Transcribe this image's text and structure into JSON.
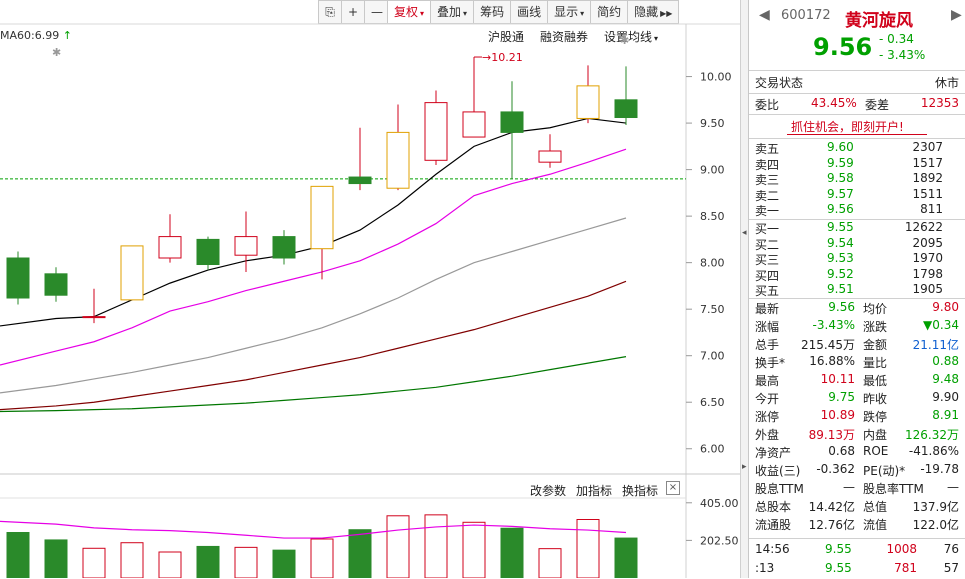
{
  "toolbar": {
    "items": [
      {
        "label": "复权",
        "active": true,
        "caret": "▾"
      },
      {
        "label": "叠加",
        "active": false,
        "caret": "▾"
      },
      {
        "label": "筹码",
        "active": false,
        "caret": ""
      },
      {
        "label": "画线",
        "active": false,
        "caret": ""
      },
      {
        "label": "显示",
        "active": false,
        "caret": "▾"
      },
      {
        "label": "简约",
        "active": false,
        "caret": ""
      },
      {
        "label": "隐藏",
        "active": false,
        "caret": "▶▶"
      }
    ],
    "icon_buttons": [
      "restore-icon",
      "plus-icon",
      "minus-icon"
    ]
  },
  "chart_header": {
    "ma60_label": "MA60:6.99",
    "links": [
      "沪股通",
      "融资融券",
      "设置均线"
    ],
    "settings_caret": "▾"
  },
  "high_marker": "10.21",
  "indicator_links": [
    "改参数",
    "加指标",
    "换指标"
  ],
  "close_symbol": "×",
  "chart_data": {
    "type": "candlestick",
    "ylim": [
      5.75,
      10.35
    ],
    "yticks": [
      "10.00",
      "9.50",
      "9.00",
      "8.50",
      "8.00",
      "7.50",
      "7.00",
      "6.50",
      "6.00"
    ],
    "ytick_values": [
      10.0,
      9.5,
      9.0,
      8.5,
      8.0,
      7.5,
      7.0,
      6.5,
      6.0
    ],
    "prev_close_line": 8.9,
    "candles": [
      {
        "o": 8.05,
        "h": 8.12,
        "l": 7.55,
        "c": 7.62
      },
      {
        "o": 7.88,
        "h": 7.95,
        "l": 7.58,
        "c": 7.65
      },
      {
        "o": 7.42,
        "h": 7.72,
        "l": 7.35,
        "c": 7.42
      },
      {
        "o": 7.6,
        "h": 8.18,
        "l": 7.6,
        "c": 8.18
      },
      {
        "o": 8.05,
        "h": 8.52,
        "l": 8.0,
        "c": 8.28
      },
      {
        "o": 8.25,
        "h": 8.28,
        "l": 7.92,
        "c": 7.98
      },
      {
        "o": 8.08,
        "h": 8.55,
        "l": 7.9,
        "c": 8.28
      },
      {
        "o": 8.28,
        "h": 8.35,
        "l": 7.98,
        "c": 8.05
      },
      {
        "o": 8.15,
        "h": 8.82,
        "l": 7.82,
        "c": 8.82
      },
      {
        "o": 8.85,
        "h": 9.45,
        "l": 8.78,
        "c": 8.92
      },
      {
        "o": 8.8,
        "h": 9.7,
        "l": 8.78,
        "c": 9.4
      },
      {
        "o": 9.1,
        "h": 9.85,
        "l": 9.05,
        "c": 9.72
      },
      {
        "o": 9.35,
        "h": 10.21,
        "l": 9.35,
        "c": 9.62
      },
      {
        "o": 9.62,
        "h": 9.95,
        "l": 8.9,
        "c": 9.4
      },
      {
        "o": 9.08,
        "h": 9.38,
        "l": 9.02,
        "c": 9.2
      },
      {
        "o": 9.55,
        "h": 10.12,
        "l": 9.5,
        "c": 9.9
      },
      {
        "o": 9.75,
        "h": 10.11,
        "l": 9.48,
        "c": 9.56
      }
    ],
    "ma": [
      {
        "name": "MA5",
        "color": "#000000",
        "values": [
          7.32,
          7.4,
          7.42,
          7.6,
          7.78,
          7.92,
          8.02,
          8.08,
          8.18,
          8.35,
          8.62,
          8.95,
          9.25,
          9.4,
          9.45,
          9.55,
          9.5
        ]
      },
      {
        "name": "MA10",
        "color": "#e600e6",
        "values": [
          6.9,
          7.05,
          7.15,
          7.3,
          7.48,
          7.58,
          7.7,
          7.8,
          7.9,
          8.02,
          8.2,
          8.42,
          8.72,
          8.85,
          8.95,
          9.08,
          9.22
        ]
      },
      {
        "name": "MA20",
        "color": "#999999",
        "values": [
          6.6,
          6.68,
          6.75,
          6.82,
          6.9,
          6.98,
          7.08,
          7.18,
          7.3,
          7.45,
          7.62,
          7.82,
          8.0,
          8.12,
          8.24,
          8.36,
          8.48
        ]
      },
      {
        "name": "MA30",
        "color": "#800000",
        "values": [
          6.42,
          6.46,
          6.5,
          6.56,
          6.62,
          6.68,
          6.74,
          6.82,
          6.9,
          6.98,
          7.08,
          7.18,
          7.28,
          7.4,
          7.52,
          7.64,
          7.8
        ]
      },
      {
        "name": "MA60",
        "color": "#007700",
        "values": [
          6.4,
          6.41,
          6.42,
          6.43,
          6.45,
          6.47,
          6.49,
          6.52,
          6.55,
          6.58,
          6.62,
          6.66,
          6.72,
          6.78,
          6.85,
          6.92,
          6.99
        ]
      }
    ],
    "volume": {
      "yticks": [
        "405.00",
        "202.50"
      ],
      "ytick_values": [
        405,
        202.5
      ],
      "ylim": [
        0,
        420
      ],
      "values": [
        245,
        205,
        160,
        190,
        140,
        170,
        165,
        150,
        210,
        260,
        335,
        340,
        300,
        268,
        158,
        315,
        215
      ],
      "ma_line": [
        305,
        290,
        270,
        260,
        255,
        245,
        230,
        215,
        215,
        235,
        258,
        275,
        285,
        278,
        265,
        258,
        245
      ]
    }
  },
  "quote": {
    "code": "600172",
    "name": "黄河旋风",
    "price": "9.56",
    "change": "- 0.34",
    "change_pct": "- 3.43%",
    "trade_status_label": "交易状态",
    "trade_status": "休市",
    "weibi_label": "委比",
    "weibi": "43.45%",
    "weicha_label": "委差",
    "weicha": "12353",
    "promo": "抓住机会，即刻开户!",
    "asks": [
      {
        "label": "卖五",
        "price": "9.60",
        "vol": "2307"
      },
      {
        "label": "卖四",
        "price": "9.59",
        "vol": "1517"
      },
      {
        "label": "卖三",
        "price": "9.58",
        "vol": "1892"
      },
      {
        "label": "卖二",
        "price": "9.57",
        "vol": "1511"
      },
      {
        "label": "卖一",
        "price": "9.56",
        "vol": "811"
      }
    ],
    "bids": [
      {
        "label": "买一",
        "price": "9.55",
        "vol": "12622"
      },
      {
        "label": "买二",
        "price": "9.54",
        "vol": "2095"
      },
      {
        "label": "买三",
        "price": "9.53",
        "vol": "1970"
      },
      {
        "label": "买四",
        "price": "9.52",
        "vol": "1798"
      },
      {
        "label": "买五",
        "price": "9.51",
        "vol": "1905"
      }
    ],
    "stats": [
      {
        "l1": "最新",
        "v1": "9.56",
        "c1": "green",
        "l2": "均价",
        "v2": "9.80",
        "c2": "red"
      },
      {
        "l1": "涨幅",
        "v1": "-3.43%",
        "c1": "green",
        "l2": "涨跌",
        "v2": "▼0.34",
        "c2": "green"
      },
      {
        "l1": "总手",
        "v1": "215.45万",
        "c1": "",
        "l2": "金额",
        "v2": "21.11亿",
        "c2": "blue"
      },
      {
        "l1": "换手*",
        "v1": "16.88%",
        "c1": "",
        "l2": "量比",
        "v2": "0.88",
        "c2": "green"
      },
      {
        "l1": "最高",
        "v1": "10.11",
        "c1": "red",
        "l2": "最低",
        "v2": "9.48",
        "c2": "green"
      },
      {
        "l1": "今开",
        "v1": "9.75",
        "c1": "green",
        "l2": "昨收",
        "v2": "9.90",
        "c2": ""
      },
      {
        "l1": "涨停",
        "v1": "10.89",
        "c1": "red",
        "l2": "跌停",
        "v2": "8.91",
        "c2": "green"
      },
      {
        "l1": "外盘",
        "v1": "89.13万",
        "c1": "red",
        "l2": "内盘",
        "v2": "126.32万",
        "c2": "green"
      },
      {
        "l1": "净资产",
        "v1": "0.68",
        "c1": "",
        "l2": "ROE",
        "v2": "-41.86%",
        "c2": ""
      },
      {
        "l1": "收益(三)",
        "v1": "-0.362",
        "c1": "",
        "l2": "PE(动)*",
        "v2": "-19.78",
        "c2": ""
      },
      {
        "l1": "股息TTM",
        "v1": "—",
        "c1": "",
        "l2": "股息率TTM",
        "v2": "—",
        "c2": ""
      },
      {
        "l1": "总股本",
        "v1": "14.42亿",
        "c1": "",
        "l2": "总值",
        "v2": "137.9亿",
        "c2": ""
      },
      {
        "l1": "流通股",
        "v1": "12.76亿",
        "c1": "",
        "l2": "流值",
        "v2": "122.0亿",
        "c2": ""
      }
    ],
    "ticks": [
      {
        "time": "14:56",
        "price": "9.55",
        "vol": "1008",
        "num": "76"
      },
      {
        "time": ":13",
        "price": "9.55",
        "vol": "781",
        "num": "57"
      }
    ]
  }
}
